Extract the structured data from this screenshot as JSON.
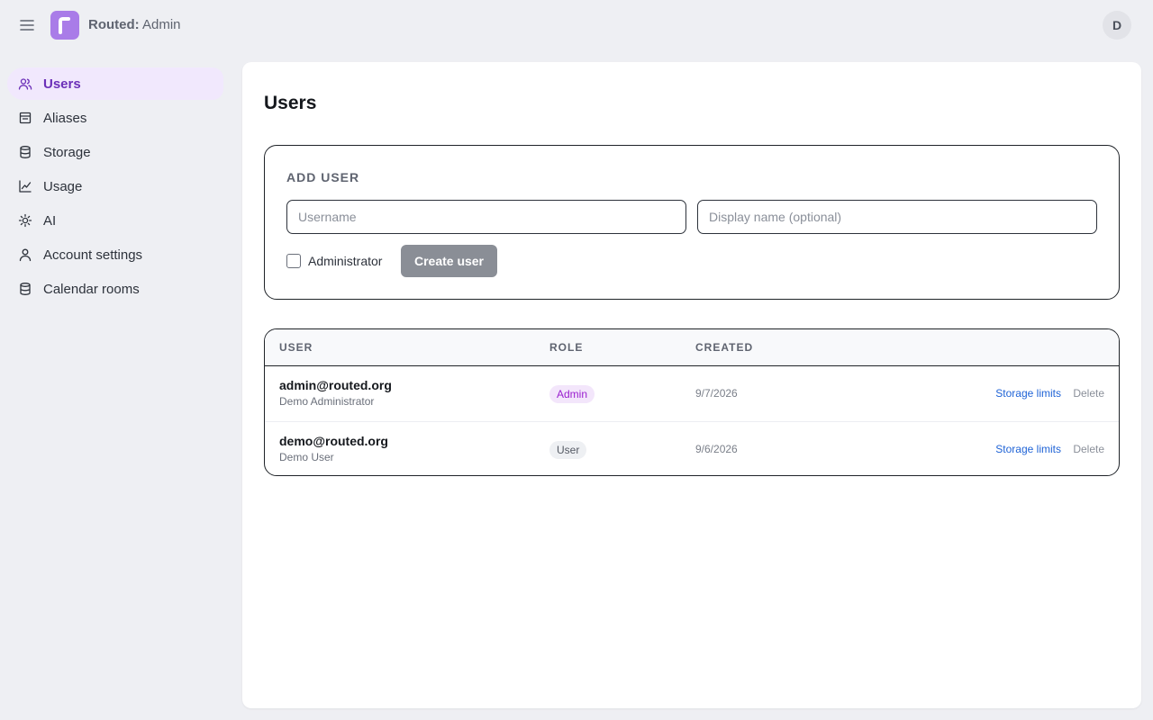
{
  "header": {
    "brand_name": "Routed:",
    "brand_suffix": " Admin",
    "avatar_initial": "D"
  },
  "sidebar": {
    "items": [
      {
        "label": "Users",
        "icon": "users-icon",
        "active": true
      },
      {
        "label": "Aliases",
        "icon": "aliases-icon"
      },
      {
        "label": "Storage",
        "icon": "database-icon"
      },
      {
        "label": "Usage",
        "icon": "chart-icon"
      },
      {
        "label": "AI",
        "icon": "sun-icon"
      },
      {
        "label": "Account settings",
        "icon": "user-icon"
      },
      {
        "label": "Calendar rooms",
        "icon": "database-icon"
      }
    ]
  },
  "main": {
    "title": "Users",
    "add_user": {
      "heading": "ADD USER",
      "username_placeholder": "Username",
      "display_placeholder": "Display name (optional)",
      "admin_label": "Administrator",
      "create_label": "Create user"
    },
    "table": {
      "columns": [
        "USER",
        "ROLE",
        "CREATED"
      ],
      "rows": [
        {
          "email": "admin@routed.org",
          "display": "Demo Administrator",
          "role": "Admin",
          "created": "9/7/2026",
          "storage_label": "Storage limits",
          "delete_label": "Delete"
        },
        {
          "email": "demo@routed.org",
          "display": "Demo User",
          "role": "User",
          "created": "9/6/2026",
          "storage_label": "Storage limits",
          "delete_label": "Delete"
        }
      ]
    }
  },
  "colors": {
    "accent": "#6b2fb8",
    "logo": "#a97ce8",
    "link": "#1f63d6",
    "admin_badge_bg": "#f3e6fb",
    "admin_badge_text": "#9a1fcf"
  }
}
